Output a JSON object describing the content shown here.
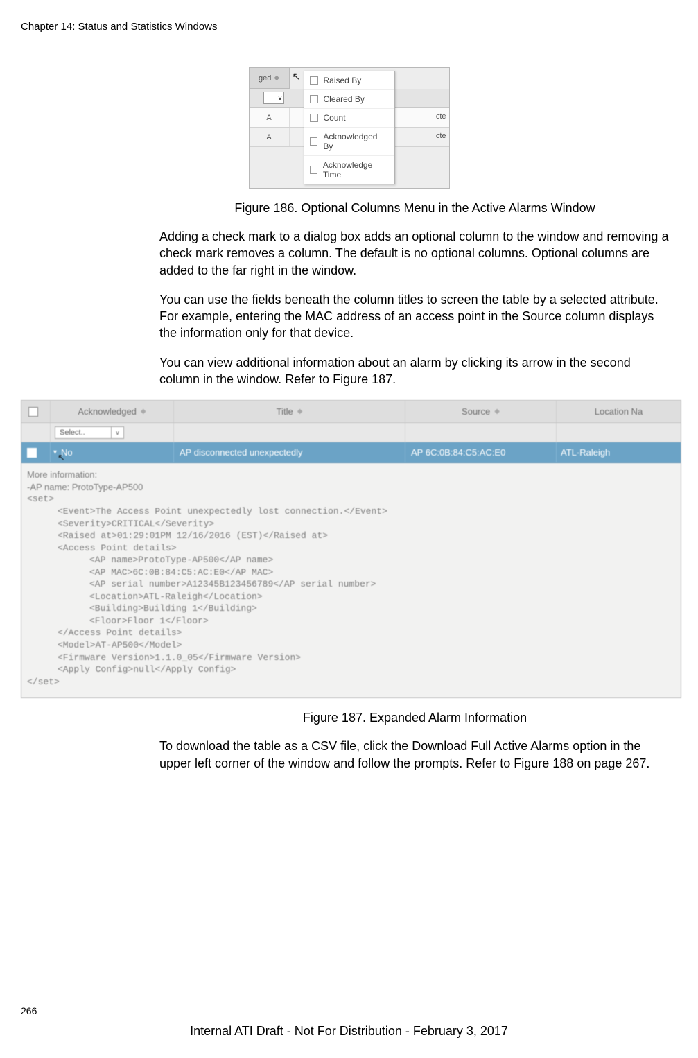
{
  "header": {
    "chapter": "Chapter 14: Status and Statistics Windows"
  },
  "figure186": {
    "tab_label": "ged",
    "rows_left": [
      "A",
      "A"
    ],
    "rows_right": [
      "cte",
      "cte"
    ],
    "menu_items": [
      "Raised By",
      "Cleared By",
      "Count",
      "Acknowledged By",
      "Acknowledge Time"
    ],
    "caption": "Figure 186. Optional Columns Menu in the Active Alarms Window"
  },
  "body": {
    "p1": "Adding a check mark to a dialog box adds an optional column to the window and removing a check mark removes a column. The default is no optional columns. Optional columns are added to the far right in the window.",
    "p2": "You can use the fields beneath the column titles to screen the table by a selected attribute. For example, entering the MAC address of an access point in the Source column displays the information only for that device.",
    "p3": "You can view additional information about an alarm by clicking its arrow in the second column in the window. Refer to Figure 187."
  },
  "figure187": {
    "columns": {
      "ack": "Acknowledged",
      "title": "Title",
      "source": "Source",
      "loc": "Location Na"
    },
    "filter": {
      "select_label": "Select.."
    },
    "selected_row": {
      "ack": "No",
      "title": "AP disconnected unexpectedly",
      "source": "AP 6C:0B:84:C5:AC:E0",
      "loc": "ATL-Raleigh"
    },
    "info_label": "More information:",
    "info_ap_name_line": "-AP name: ProtoType-AP500",
    "xml": {
      "open_set": "<set>",
      "event": "<Event>The Access Point unexpectedly lost connection.</Event>",
      "severity": "<Severity>CRITICAL</Severity>",
      "raised": "<Raised at>01:29:01PM 12/16/2016 (EST)</Raised at>",
      "apd_open": "<Access Point details>",
      "ap_name": "<AP name>ProtoType-AP500</AP name>",
      "ap_mac": "<AP MAC>6C:0B:84:C5:AC:E0</AP MAC>",
      "ap_serial": "<AP serial number>A12345B123456789</AP serial number>",
      "loc": "<Location>ATL-Raleigh</Location>",
      "building": "<Building>Building 1</Building>",
      "floor": "<Floor>Floor 1</Floor>",
      "apd_close": "</Access Point details>",
      "model": "<Model>AT-AP500</Model>",
      "fw": "<Firmware Version>1.1.0_05</Firmware Version>",
      "apply": "<Apply Config>null</Apply Config>",
      "close_set": "</set>"
    },
    "caption": "Figure 187. Expanded Alarm Information"
  },
  "body2": {
    "p4": "To download the table as a CSV file, click the Download Full Active Alarms option in the upper left corner of the window and follow the prompts. Refer to Figure 188 on page 267."
  },
  "footer": {
    "page_num": "266",
    "line": "Internal ATI Draft - Not For Distribution - February 3, 2017"
  }
}
